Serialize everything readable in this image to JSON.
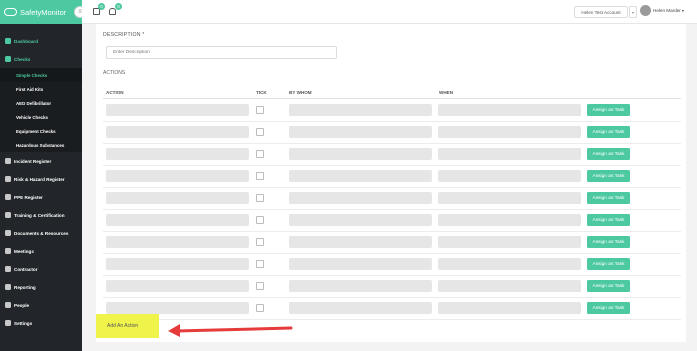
{
  "brand": {
    "name": "SafetyMonitor",
    "accent": "#4cc9a0"
  },
  "topbar": {
    "badges": [
      "0",
      "0"
    ],
    "account": "Helen Test Account",
    "user_name": "Helen Marder"
  },
  "sidebar": {
    "items": [
      {
        "label": "Dashboard",
        "active": true
      },
      {
        "label": "Checks",
        "active": true
      },
      {
        "label": "Incident Register"
      },
      {
        "label": "Risk & Hazard Register"
      },
      {
        "label": "PPE Register"
      },
      {
        "label": "Training & Certification"
      },
      {
        "label": "Documents & Resources"
      },
      {
        "label": "Meetings"
      },
      {
        "label": "Contractor"
      },
      {
        "label": "Reporting"
      },
      {
        "label": "People"
      },
      {
        "label": "Settings"
      }
    ],
    "checks_sub": [
      {
        "label": "Simple Checks",
        "active": true
      },
      {
        "label": "First Aid Kits"
      },
      {
        "label": "AED Defibrillator"
      },
      {
        "label": "Vehicle Checks"
      },
      {
        "label": "Equipment Checks"
      },
      {
        "label": "Hazardous Substances"
      }
    ]
  },
  "form": {
    "description_label": "DESCRIPTION *",
    "description_placeholder": "Enter Description",
    "actions_label": "ACTIONS",
    "columns": [
      "ACTION",
      "TICK",
      "BY WHOM",
      "WHEN"
    ],
    "assign_label": "Assign as Task",
    "row_count": 10,
    "add_action_label": "Add An Action"
  }
}
